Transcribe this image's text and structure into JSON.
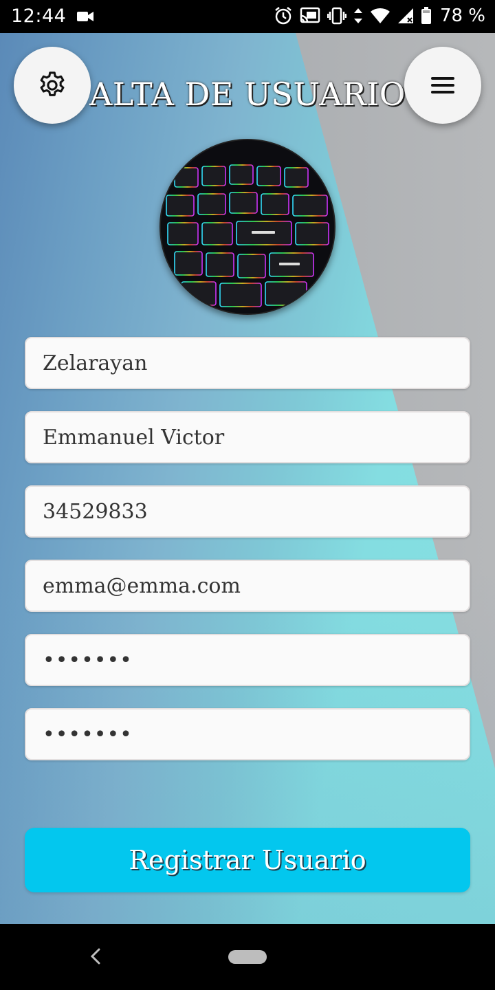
{
  "status_bar": {
    "time": "12:44",
    "battery_percent": "78 %",
    "icons": [
      "video-camera-icon",
      "alarm-icon",
      "cast-icon",
      "vibrate-icon",
      "data-arrows-icon",
      "wifi-icon",
      "signal-icon",
      "battery-icon"
    ]
  },
  "header": {
    "title": "ALTA DE USUARIO",
    "settings_icon": "gear-icon",
    "menu_icon": "hamburger-menu-icon"
  },
  "avatar": {
    "description_icon": "keyboard-photo"
  },
  "form": {
    "apellido_value": "Zelarayan",
    "nombre_value": "Emmanuel Victor",
    "dni_value": "34529833",
    "email_value": "emma@emma.com",
    "password_value": "•••••••",
    "password_confirm_value": "•••••••"
  },
  "actions": {
    "register_label": "Registrar Usuario"
  },
  "colors": {
    "accent_button": "#03c7ee",
    "gradient_left": "#5b8ab8",
    "gradient_right": "#86e0e2",
    "gray_panel": "#a9acaf"
  }
}
